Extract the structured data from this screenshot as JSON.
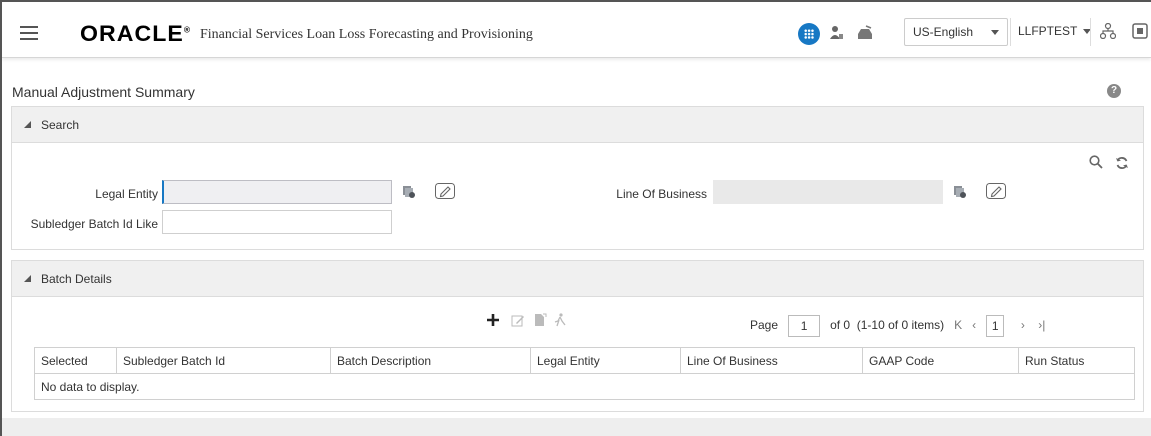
{
  "header": {
    "brand": "ORACLE",
    "brand_mark": "®",
    "app_title": "Financial Services Loan Loss Forecasting and Provisioning",
    "language": "US-English",
    "user": "LLFPTEST"
  },
  "page": {
    "title": "Manual Adjustment Summary",
    "help_glyph": "?"
  },
  "search": {
    "section_title": "Search",
    "legal_entity_label": "Legal Entity",
    "legal_entity_value": "",
    "line_of_business_label": "Line Of Business",
    "line_of_business_value": "",
    "subledger_label": "Subledger Batch Id Like",
    "subledger_value": ""
  },
  "batch": {
    "section_title": "Batch Details",
    "pager": {
      "page_label": "Page",
      "page_value": "1",
      "of_text": "of 0",
      "items_text": "(1-10 of 0 items)",
      "current": "1"
    },
    "columns": [
      "Selected",
      "Subledger Batch Id",
      "Batch Description",
      "Legal Entity",
      "Line Of Business",
      "GAAP Code",
      "Run Status"
    ],
    "empty_text": "No data to display."
  },
  "colors": {
    "accent": "#1778c4",
    "panel_header": "#f0f0f0"
  }
}
